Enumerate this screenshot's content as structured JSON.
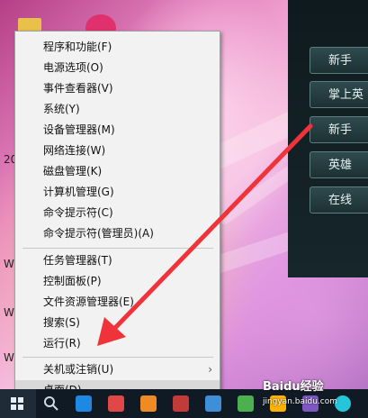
{
  "context_menu": {
    "items": [
      {
        "label": "程序和功能(F)"
      },
      {
        "label": "电源选项(O)"
      },
      {
        "label": "事件查看器(V)"
      },
      {
        "label": "系统(Y)"
      },
      {
        "label": "设备管理器(M)"
      },
      {
        "label": "网络连接(W)"
      },
      {
        "label": "磁盘管理(K)"
      },
      {
        "label": "计算机管理(G)"
      },
      {
        "label": "命令提示符(C)"
      },
      {
        "label": "命令提示符(管理员)(A)"
      },
      {
        "label": "任务管理器(T)"
      },
      {
        "label": "控制面板(P)"
      },
      {
        "label": "文件资源管理器(E)"
      },
      {
        "label": "搜索(S)"
      },
      {
        "label": "运行(R)"
      },
      {
        "label": "关机或注销(U)",
        "submenu_icon": "chevron-right-icon"
      },
      {
        "label": "桌面(D)",
        "highlighted": true
      }
    ],
    "submenu_glyph": "›"
  },
  "game_panel": {
    "buttons": [
      {
        "label": "新手"
      },
      {
        "label": "掌上英"
      },
      {
        "label": "新手"
      },
      {
        "label": "英雄"
      },
      {
        "label": "在线"
      }
    ]
  },
  "desktop": {
    "side_text": [
      "20",
      "W",
      "W",
      "W"
    ]
  },
  "taskbar": {
    "icons": [
      "windows-start-icon",
      "search-icon",
      "app-icon-blue",
      "app-icon-media",
      "app-icon-orange",
      "app-icon-green",
      "app-icon-paint",
      "app-icon-yellow",
      "app-icon-network",
      "app-icon-browser"
    ]
  },
  "watermark": {
    "text": "Baidu经验",
    "sub": "jingyan.baidu.com"
  },
  "colors": {
    "arrow": "#f0333a",
    "menu_bg": "#f2f2f2",
    "highlight": "#d9d9d9",
    "taskbar": "#101a24"
  }
}
